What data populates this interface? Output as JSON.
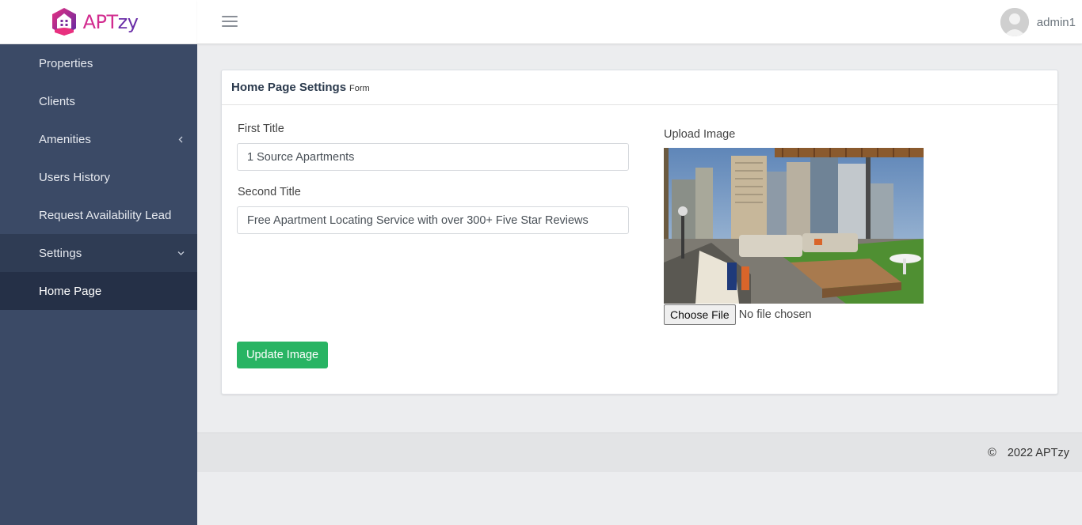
{
  "brand": {
    "name_part1": "APT",
    "name_part2": "zy",
    "colors": {
      "pink": "#d22c8f",
      "purple": "#6b2fa8"
    }
  },
  "sidebar": {
    "items": [
      {
        "label": "Properties"
      },
      {
        "label": "Clients"
      },
      {
        "label": "Amenities",
        "icon": "chevron-left-icon"
      },
      {
        "label": "Users History"
      },
      {
        "label": "Request Availability Lead"
      },
      {
        "label": "Settings",
        "icon": "chevron-down-icon"
      },
      {
        "label": "Home Page"
      }
    ]
  },
  "topbar": {
    "menu_icon": "hamburger-icon",
    "user_name": "admin1",
    "avatar_icon": "user-avatar-icon"
  },
  "card": {
    "title": "Home Page Settings",
    "subtitle": "Form",
    "first_title_label": "First Title",
    "first_title_value": "1 Source Apartments",
    "second_title_label": "Second Title",
    "second_title_value": "Free Apartment Locating Service with over 300+ Five Star Reviews",
    "upload_label": "Upload Image",
    "choose_file_label": "Choose File",
    "file_status": "No file chosen",
    "update_button": "Update Image"
  },
  "footer": {
    "copyright_symbol": "©",
    "text": "2022 APTzy"
  },
  "colors": {
    "sidebar_bg": "#3b4a66",
    "active_bg": "#253047",
    "update_button_bg": "#28b463"
  }
}
